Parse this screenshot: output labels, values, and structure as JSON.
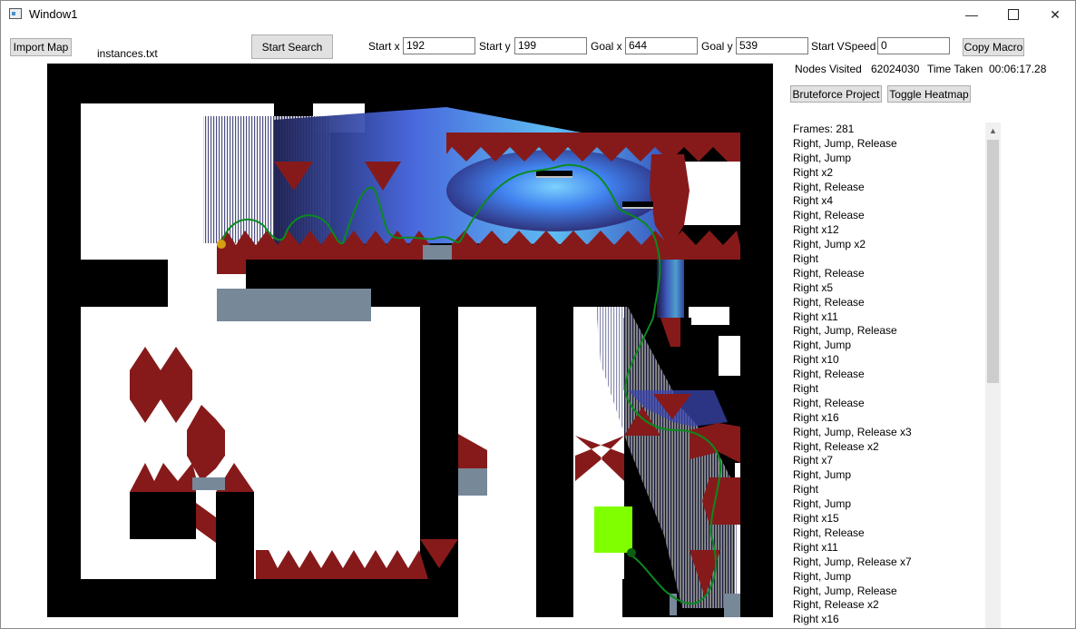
{
  "window": {
    "title": "Window1",
    "controls": {
      "minimize": "—",
      "maximize": "",
      "close": "✕"
    }
  },
  "toolbar": {
    "import_label": "Import Map",
    "file_name": "instances.txt",
    "start_search_label": "Start Search",
    "start_x_label": "Start x",
    "start_x_value": "192",
    "start_y_label": "Start y",
    "start_y_value": "199",
    "goal_x_label": "Goal x",
    "goal_x_value": "644",
    "goal_y_label": "Goal y",
    "goal_y_value": "539",
    "start_vspeed_label": "Start VSpeed",
    "start_vspeed_value": "0",
    "copy_macro_label": "Copy Macro"
  },
  "stats": {
    "nodes_visited_label": "Nodes Visited",
    "nodes_visited_value": "62024030",
    "time_taken_label": "Time Taken",
    "time_taken_value": "00:06:17.28"
  },
  "actions": {
    "bruteforce_label": "Bruteforce Project",
    "heatmap_label": "Toggle Heatmap"
  },
  "macro_list": [
    "Frames: 281",
    "Right, Jump, Release",
    "Right, Jump",
    "Right x2",
    "Right, Release",
    "Right x4",
    "Right, Release",
    "Right x12",
    "Right, Jump x2",
    "Right",
    "Right, Release",
    "Right x5",
    "Right, Release",
    "Right x11",
    "Right, Jump, Release",
    "Right, Jump",
    "Right x10",
    "Right, Release",
    "Right",
    "Right, Release",
    "Right x16",
    "Right, Jump, Release x3",
    "Right, Release x2",
    "Right x7",
    "Right, Jump",
    "Right",
    "Right, Jump",
    "Right x15",
    "Right, Release",
    "Right x11",
    "Right, Jump, Release x7",
    "Right, Jump",
    "Right, Jump, Release",
    "Right, Release x2",
    "Right x16"
  ],
  "scrollbar": {
    "up_arrow_icon": "chevron-up-icon"
  },
  "map_colors": {
    "wall": "#000000",
    "spike": "#861a1a",
    "platform": "#778899",
    "goal": "#80ff00",
    "path": "#0a8a1e",
    "start": "#d4a010",
    "end_marker": "#0b5e12"
  }
}
